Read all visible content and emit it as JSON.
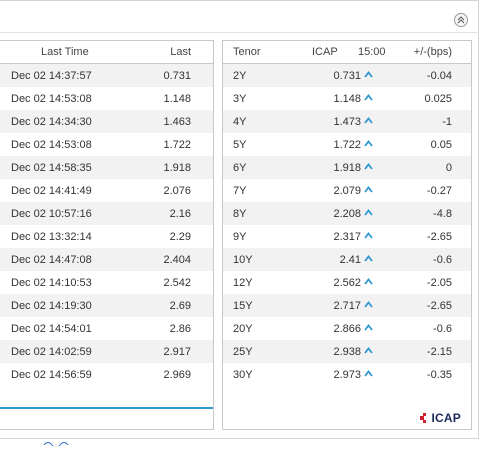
{
  "left_table": {
    "headers": {
      "time": "Last Time",
      "last": "Last"
    },
    "rows": [
      {
        "time": "Dec 02 14:37:57",
        "last": "0.731"
      },
      {
        "time": "Dec 02 14:53:08",
        "last": "1.148"
      },
      {
        "time": "Dec 02 14:34:30",
        "last": "1.463"
      },
      {
        "time": "Dec 02 14:53:08",
        "last": "1.722"
      },
      {
        "time": "Dec 02 14:58:35",
        "last": "1.918"
      },
      {
        "time": "Dec 02 14:41:49",
        "last": "2.076"
      },
      {
        "time": "Dec 02 10:57:16",
        "last": "2.16"
      },
      {
        "time": "Dec 02 13:32:14",
        "last": "2.29"
      },
      {
        "time": "Dec 02 14:47:08",
        "last": "2.404"
      },
      {
        "time": "Dec 02 14:10:53",
        "last": "2.542"
      },
      {
        "time": "Dec 02 14:19:30",
        "last": "2.69"
      },
      {
        "time": "Dec 02 14:54:01",
        "last": "2.86"
      },
      {
        "time": "Dec 02 14:02:59",
        "last": "2.917"
      },
      {
        "time": "Dec 02 14:56:59",
        "last": "2.969"
      }
    ]
  },
  "right_table": {
    "headers": {
      "tenor": "Tenor",
      "icap": "ICAP",
      "time": "15:00",
      "change": "+/-(bps)"
    },
    "rows": [
      {
        "tenor": "2Y",
        "icap": "0.731",
        "change": "-0.04"
      },
      {
        "tenor": "3Y",
        "icap": "1.148",
        "change": "0.025"
      },
      {
        "tenor": "4Y",
        "icap": "1.473",
        "change": "-1"
      },
      {
        "tenor": "5Y",
        "icap": "1.722",
        "change": "0.05"
      },
      {
        "tenor": "6Y",
        "icap": "1.918",
        "change": "0"
      },
      {
        "tenor": "7Y",
        "icap": "2.079",
        "change": "-0.27"
      },
      {
        "tenor": "8Y",
        "icap": "2.208",
        "change": "-4.8"
      },
      {
        "tenor": "9Y",
        "icap": "2.317",
        "change": "-2.65"
      },
      {
        "tenor": "10Y",
        "icap": "2.41",
        "change": "-0.6"
      },
      {
        "tenor": "12Y",
        "icap": "2.562",
        "change": "-2.05"
      },
      {
        "tenor": "15Y",
        "icap": "2.717",
        "change": "-2.65"
      },
      {
        "tenor": "20Y",
        "icap": "2.866",
        "change": "-0.6"
      },
      {
        "tenor": "25Y",
        "icap": "2.938",
        "change": "-2.15"
      },
      {
        "tenor": "30Y",
        "icap": "2.973",
        "change": "-0.35"
      }
    ],
    "trend_icon": "up-arrow-icon"
  },
  "logo": {
    "text": "ICAP"
  },
  "colors": {
    "accent": "#2f9ad1",
    "arrow": "#2f9ad1",
    "logo_red": "#d0202e",
    "logo_navy": "#1b2a5b"
  }
}
